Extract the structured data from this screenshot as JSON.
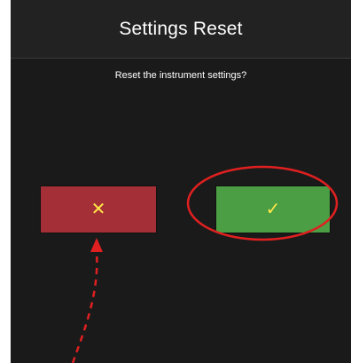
{
  "dialog": {
    "title": "Settings Reset",
    "message": "Reset the instrument settings?"
  },
  "buttons": {
    "cancel": {
      "label": "✕",
      "icon": "close-icon",
      "color": "#a52f36"
    },
    "confirm": {
      "label": "✓",
      "icon": "check-icon",
      "color": "#4b9e43"
    }
  },
  "colors": {
    "background": "#1a1a1a",
    "header": "#222222",
    "icon": "#ffe74a",
    "annotation": "#e02020"
  }
}
